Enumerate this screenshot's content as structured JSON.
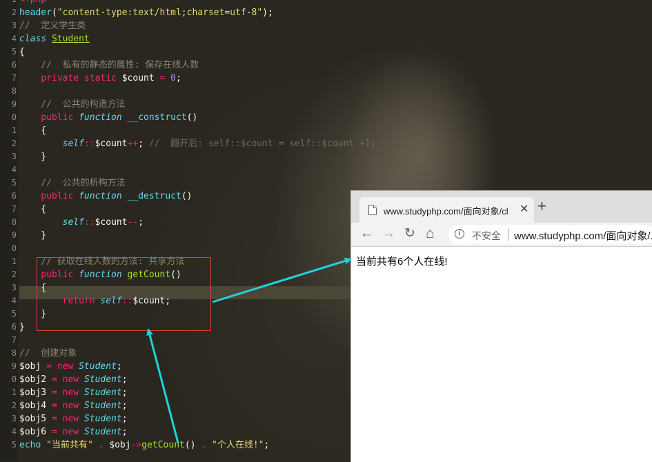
{
  "editor": {
    "line_numbers": [
      "1",
      "2",
      "3",
      "4",
      "5",
      "6",
      "7",
      "8",
      "9",
      "0",
      "1",
      "2",
      "3",
      "4",
      "5",
      "6",
      "7",
      "8",
      "9",
      "0",
      "1",
      "2",
      "3",
      "4",
      "5",
      "6",
      "7",
      "8",
      "9",
      "0",
      "1",
      "2",
      "3",
      "4",
      "5"
    ],
    "lines": [
      [
        {
          "t": "<?php",
          "c": "c-kw"
        }
      ],
      [
        {
          "t": "header",
          "c": "c-cyan"
        },
        {
          "t": "(",
          "c": "c-var"
        },
        {
          "t": "\"content-type:text/html;charset=utf-8\"",
          "c": "c-str"
        },
        {
          "t": ");",
          "c": "c-var"
        }
      ],
      [
        {
          "t": "//  定义学生类",
          "c": "c-com"
        }
      ],
      [
        {
          "t": "class",
          "c": "c-kwi"
        },
        {
          "t": " ",
          "c": "c-var"
        },
        {
          "t": "Student",
          "c": "c-cls"
        }
      ],
      [
        {
          "t": "{",
          "c": "c-var"
        }
      ],
      [
        {
          "t": "    //  私有的静态的属性: 保存在线人数",
          "c": "c-com"
        }
      ],
      [
        {
          "t": "    private static ",
          "c": "c-kw"
        },
        {
          "t": "$count",
          "c": "c-var"
        },
        {
          "t": " = ",
          "c": "c-kw"
        },
        {
          "t": "0",
          "c": "c-num"
        },
        {
          "t": ";",
          "c": "c-var"
        }
      ],
      [],
      [
        {
          "t": "    //  公共的构造方法",
          "c": "c-com"
        }
      ],
      [
        {
          "t": "    public ",
          "c": "c-kw"
        },
        {
          "t": "function",
          "c": "c-kwi"
        },
        {
          "t": " ",
          "c": "c-var"
        },
        {
          "t": "__construct",
          "c": "c-cyan"
        },
        {
          "t": "()",
          "c": "c-var"
        }
      ],
      [
        {
          "t": "    {",
          "c": "c-var"
        }
      ],
      [
        {
          "t": "        ",
          "c": "c-var"
        },
        {
          "t": "self",
          "c": "c-kwi"
        },
        {
          "t": "::",
          "c": "c-kw"
        },
        {
          "t": "$count",
          "c": "c-var"
        },
        {
          "t": "++",
          "c": "c-kw"
        },
        {
          "t": "; ",
          "c": "c-var"
        },
        {
          "t": "//  翻开后: self::$count = self::$count +1;",
          "c": "c-dimv"
        }
      ],
      [
        {
          "t": "    }",
          "c": "c-var"
        }
      ],
      [],
      [
        {
          "t": "    //  公共的析构方法",
          "c": "c-com"
        }
      ],
      [
        {
          "t": "    public ",
          "c": "c-kw"
        },
        {
          "t": "function",
          "c": "c-kwi"
        },
        {
          "t": " ",
          "c": "c-var"
        },
        {
          "t": "__destruct",
          "c": "c-cyan"
        },
        {
          "t": "()",
          "c": "c-var"
        }
      ],
      [
        {
          "t": "    {",
          "c": "c-var"
        }
      ],
      [
        {
          "t": "        ",
          "c": "c-var"
        },
        {
          "t": "self",
          "c": "c-kwi"
        },
        {
          "t": "::",
          "c": "c-kw"
        },
        {
          "t": "$count",
          "c": "c-var"
        },
        {
          "t": "--",
          "c": "c-kw"
        },
        {
          "t": ";",
          "c": "c-var"
        }
      ],
      [
        {
          "t": "    }",
          "c": "c-var"
        }
      ],
      [],
      [
        {
          "t": "    // 获取在线人数的方法: 共享方法",
          "c": "c-com"
        }
      ],
      [
        {
          "t": "    public ",
          "c": "c-kw"
        },
        {
          "t": "function",
          "c": "c-kwi"
        },
        {
          "t": " ",
          "c": "c-var"
        },
        {
          "t": "getCount",
          "c": "c-fn"
        },
        {
          "t": "()",
          "c": "c-var"
        }
      ],
      [
        {
          "t": "    {",
          "c": "c-var"
        }
      ],
      [
        {
          "t": "        return ",
          "c": "c-kw"
        },
        {
          "t": "self",
          "c": "c-kwi"
        },
        {
          "t": "::",
          "c": "c-kw"
        },
        {
          "t": "$count",
          "c": "c-var"
        },
        {
          "t": ";",
          "c": "c-var"
        }
      ],
      [
        {
          "t": "    }",
          "c": "c-var"
        }
      ],
      [
        {
          "t": "}",
          "c": "c-var"
        }
      ],
      [],
      [
        {
          "t": "//  创建对象",
          "c": "c-com"
        }
      ],
      [
        {
          "t": "$obj",
          "c": "c-var"
        },
        {
          "t": " = ",
          "c": "c-kw"
        },
        {
          "t": "new ",
          "c": "c-kw"
        },
        {
          "t": "Student",
          "c": "c-kwi"
        },
        {
          "t": ";",
          "c": "c-var"
        }
      ],
      [
        {
          "t": "$obj2",
          "c": "c-var"
        },
        {
          "t": " = ",
          "c": "c-kw"
        },
        {
          "t": "new ",
          "c": "c-kw"
        },
        {
          "t": "Student",
          "c": "c-kwi"
        },
        {
          "t": ";",
          "c": "c-var"
        }
      ],
      [
        {
          "t": "$obj3",
          "c": "c-var"
        },
        {
          "t": " = ",
          "c": "c-kw"
        },
        {
          "t": "new ",
          "c": "c-kw"
        },
        {
          "t": "Student",
          "c": "c-kwi"
        },
        {
          "t": ";",
          "c": "c-var"
        }
      ],
      [
        {
          "t": "$obj4",
          "c": "c-var"
        },
        {
          "t": " = ",
          "c": "c-kw"
        },
        {
          "t": "new ",
          "c": "c-kw"
        },
        {
          "t": "Student",
          "c": "c-kwi"
        },
        {
          "t": ";",
          "c": "c-var"
        }
      ],
      [
        {
          "t": "$obj5",
          "c": "c-var"
        },
        {
          "t": " = ",
          "c": "c-kw"
        },
        {
          "t": "new ",
          "c": "c-kw"
        },
        {
          "t": "Student",
          "c": "c-kwi"
        },
        {
          "t": ";",
          "c": "c-var"
        }
      ],
      [
        {
          "t": "$obj6",
          "c": "c-var"
        },
        {
          "t": " = ",
          "c": "c-kw"
        },
        {
          "t": "new ",
          "c": "c-kw"
        },
        {
          "t": "Student",
          "c": "c-kwi"
        },
        {
          "t": ";",
          "c": "c-var"
        }
      ],
      [
        {
          "t": "echo ",
          "c": "c-cyan"
        },
        {
          "t": "\"当前共有\"",
          "c": "c-str"
        },
        {
          "t": " . ",
          "c": "c-kw"
        },
        {
          "t": "$obj",
          "c": "c-var"
        },
        {
          "t": "->",
          "c": "c-kw"
        },
        {
          "t": "getCount",
          "c": "c-fn"
        },
        {
          "t": "() ",
          "c": "c-var"
        },
        {
          "t": ".",
          "c": "c-kw"
        },
        {
          "t": " ",
          "c": "c-var"
        },
        {
          "t": "\"个人在线!\"",
          "c": "c-str"
        },
        {
          "t": ";",
          "c": "c-var"
        }
      ]
    ]
  },
  "browser": {
    "tab_title": "www.studyphp.com/面向对象/cl",
    "tab_close": "✕",
    "new_tab": "+",
    "back": "←",
    "forward": "→",
    "reload": "↻",
    "home": "⌂",
    "info": "i",
    "security_label": "不安全",
    "url": "www.studyphp.com/面向对象/...",
    "page_text": "当前共有6个人在线!"
  },
  "colors": {
    "annotation_box": "#e0413a",
    "arrow": "#1fd3d9"
  }
}
